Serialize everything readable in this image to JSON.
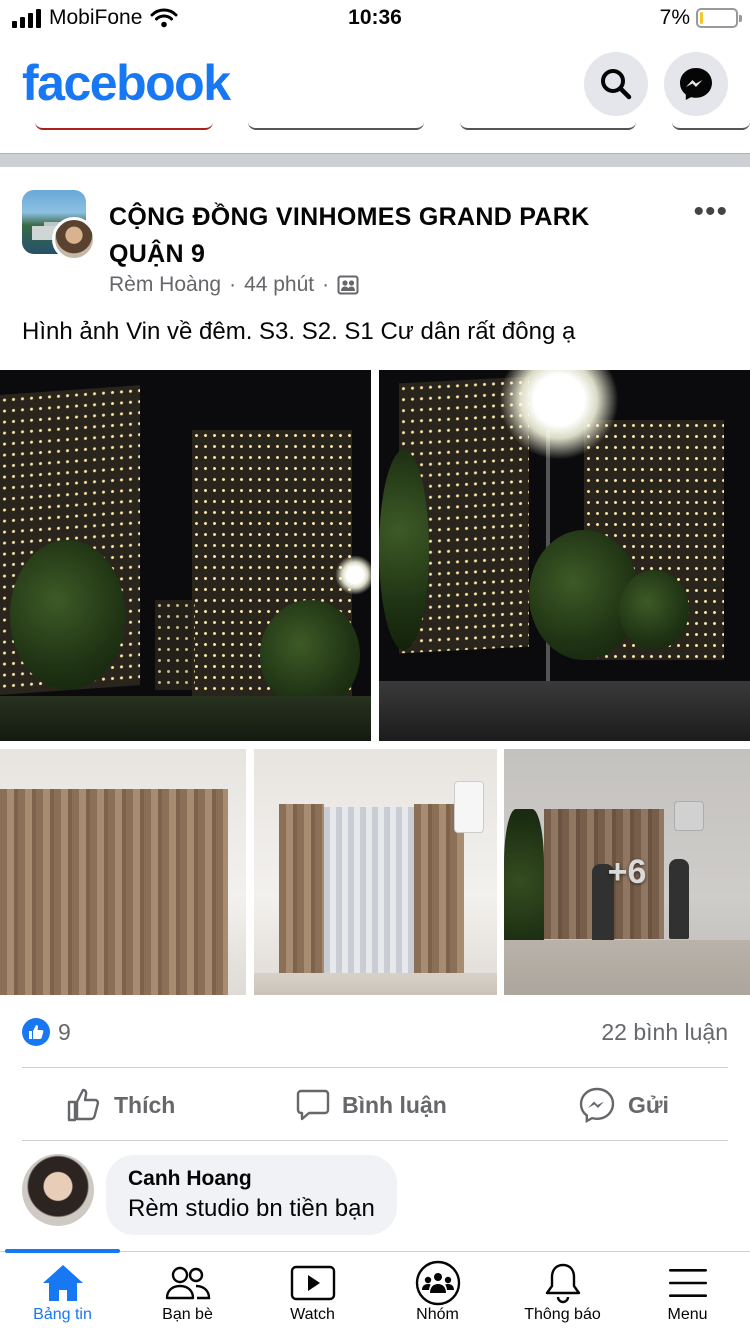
{
  "status_bar": {
    "carrier": "MobiFone",
    "time": "10:36",
    "battery": "7%",
    "battery_level": 0.07
  },
  "header": {
    "logo": "facebook",
    "search_icon": "search-icon",
    "messenger_icon": "messenger-icon"
  },
  "post": {
    "group_name": "CỘNG ĐỒNG VINHOMES GRAND PARK QUẬN 9",
    "author": "Rèm Hoàng",
    "time": "44 phút",
    "privacy_icon": "group-privacy-icon",
    "text": "Hình ảnh Vin về đêm. S3. S2.  S1 Cư dân rất đông ạ",
    "more_photos": "+6",
    "likes": "9",
    "comments": "22 bình luận",
    "actions": {
      "like": "Thích",
      "comment": "Bình luận",
      "send": "Gửi"
    }
  },
  "comment": {
    "name": "Canh Hoang",
    "text": "Rèm studio bn tiền bạn"
  },
  "tabbar": {
    "active": "news-feed",
    "tabs": [
      {
        "id": "news-feed",
        "label": "Bảng tin",
        "icon": "home-icon"
      },
      {
        "id": "friends",
        "label": "Bạn bè",
        "icon": "friends-icon"
      },
      {
        "id": "watch",
        "label": "Watch",
        "icon": "watch-icon"
      },
      {
        "id": "groups",
        "label": "Nhóm",
        "icon": "groups-icon"
      },
      {
        "id": "notifications",
        "label": "Thông báo",
        "icon": "bell-icon"
      },
      {
        "id": "menu",
        "label": "Menu",
        "icon": "menu-icon"
      }
    ]
  },
  "colors": {
    "brand": "#1877f2",
    "secondary_text": "#65676b",
    "separator": "#ccd0d5"
  }
}
